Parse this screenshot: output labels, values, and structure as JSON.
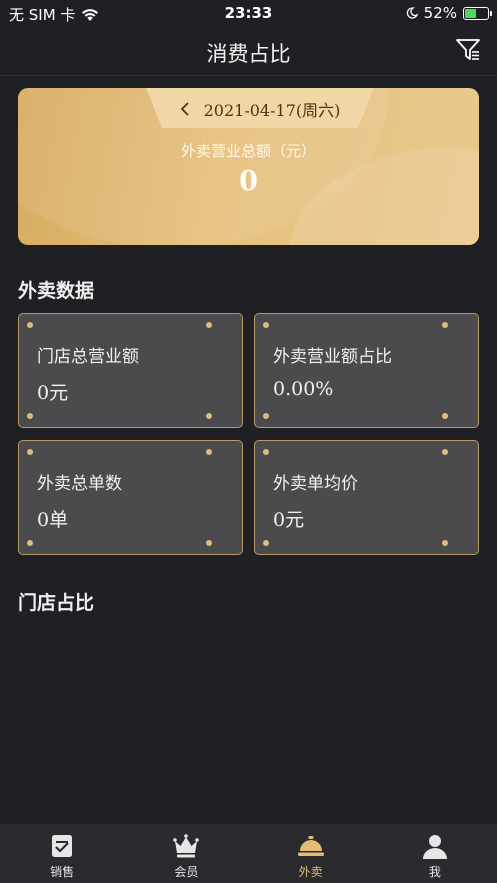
{
  "status_bar": {
    "carrier": "无 SIM 卡",
    "time": "23:33",
    "battery_percent": "52%",
    "battery_level": 0.52
  },
  "nav": {
    "title": "消费占比",
    "filter_icon": "filter-icon"
  },
  "summary": {
    "date": "2021-04-17(周六)",
    "label": "外卖营业总额（元）",
    "amount": "0"
  },
  "takeout_section": {
    "title": "外卖数据",
    "cards": [
      {
        "name": "门店总营业额",
        "value": "0元"
      },
      {
        "name": "外卖营业额占比",
        "value": "0.00%"
      },
      {
        "name": "外卖总单数",
        "value": "0单"
      },
      {
        "name": "外卖单均价",
        "value": "0元"
      }
    ]
  },
  "store_section": {
    "title": "门店占比"
  },
  "tabbar": {
    "items": [
      {
        "label": "销售",
        "icon": "sales-icon",
        "active": false
      },
      {
        "label": "会员",
        "icon": "crown-icon",
        "active": false
      },
      {
        "label": "外卖",
        "icon": "cloche-icon",
        "active": true
      },
      {
        "label": "我",
        "icon": "user-icon",
        "active": false
      }
    ]
  },
  "colors": {
    "background": "#1f2024",
    "gold_accent": "#e3bd75",
    "card_bg": "#4b4b4d",
    "tabbar_bg": "#2b2b2f"
  }
}
